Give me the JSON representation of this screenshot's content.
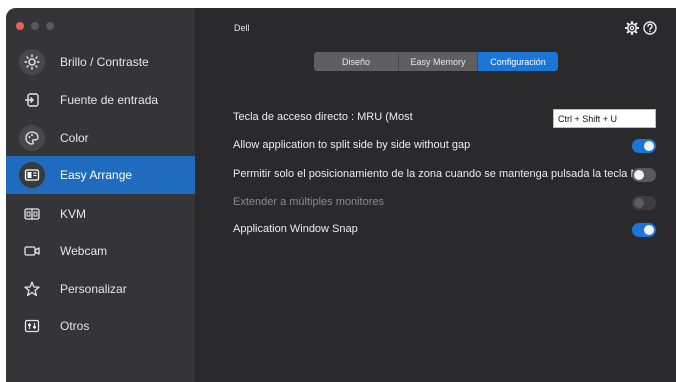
{
  "window": {
    "title": "Dell"
  },
  "traffic_lights": [
    {
      "name": "close",
      "color": "#ec5f57"
    },
    {
      "name": "minimize",
      "color": "#5a5a5d"
    },
    {
      "name": "zoom",
      "color": "#5a5a5d"
    }
  ],
  "sidebar": {
    "items": [
      {
        "label": "Brillo / Contraste",
        "icon": "sun-icon",
        "active": false
      },
      {
        "label": "Fuente de entrada",
        "icon": "input-source-icon",
        "active": false
      },
      {
        "label": "Color",
        "icon": "palette-icon",
        "active": false
      },
      {
        "label": "Easy Arrange",
        "icon": "layout-icon",
        "active": true
      },
      {
        "label": "KVM",
        "icon": "kvm-icon",
        "active": false
      },
      {
        "label": "Webcam",
        "icon": "webcam-icon",
        "active": false
      },
      {
        "label": "Personalizar",
        "icon": "star-icon",
        "active": false
      },
      {
        "label": "Otros",
        "icon": "others-icon",
        "active": false
      }
    ]
  },
  "header": {
    "settings_icon": "gear-icon",
    "help_icon": "help-icon"
  },
  "tabs": [
    {
      "label": "Diseño",
      "active": false
    },
    {
      "label": "Easy Memory",
      "active": false
    },
    {
      "label": "Configuración",
      "active": true
    }
  ],
  "settings": {
    "hotkey": {
      "label": "Tecla de acceso directo : MRU (Most",
      "value": "Ctrl + Shift + U"
    },
    "split_no_gap": {
      "label": "Allow application to split side by side without gap",
      "state": "on"
    },
    "zone_hold_key": {
      "label": "Permitir solo el posicionamiento de la zona cuando se mantenga pulsada la tecla MA",
      "state": "off"
    },
    "extend_monitors": {
      "label": "Extender a múltiples monitores",
      "state": "disabled"
    },
    "window_snap": {
      "label": "Application Window Snap",
      "state": "on"
    }
  },
  "colors": {
    "accent": "#1a77d8",
    "sidebar_active": "#1f6bbd",
    "sidebar_bg": "#353538",
    "main_bg": "#2a2a2c"
  }
}
